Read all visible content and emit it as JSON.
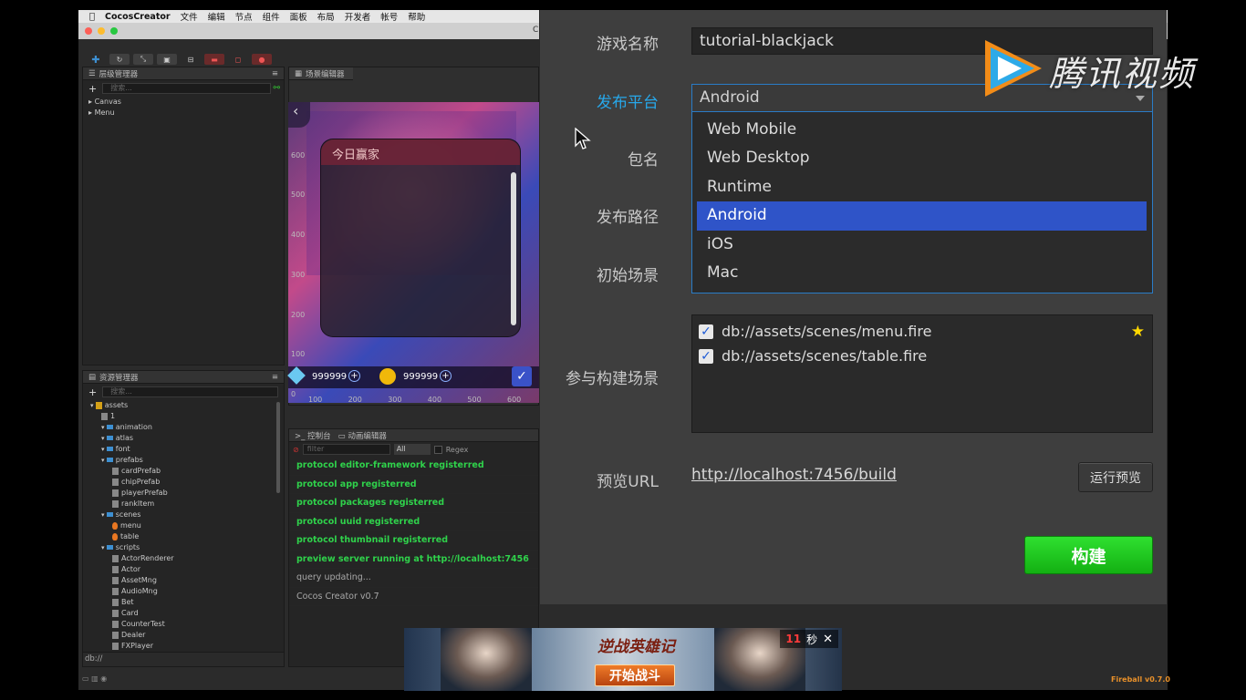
{
  "menubar": {
    "app_name": "CocosCreator",
    "items": [
      "文件",
      "编辑",
      "节点",
      "组件",
      "面板",
      "布局",
      "开发者",
      "帐号",
      "帮助"
    ]
  },
  "window": {
    "title": "C"
  },
  "hierarchy": {
    "title": "层级管理器",
    "search_placeholder": "搜索...",
    "nodes": [
      "Canvas",
      "Menu"
    ]
  },
  "assets": {
    "title": "资源管理器",
    "search_placeholder": "搜索...",
    "tree": [
      {
        "label": "assets",
        "indent": 0,
        "type": "root"
      },
      {
        "label": "1",
        "indent": 1,
        "type": "file"
      },
      {
        "label": "animation",
        "indent": 1,
        "type": "folder"
      },
      {
        "label": "atlas",
        "indent": 1,
        "type": "folder"
      },
      {
        "label": "font",
        "indent": 1,
        "type": "folder"
      },
      {
        "label": "prefabs",
        "indent": 1,
        "type": "folder"
      },
      {
        "label": "cardPrefab",
        "indent": 2,
        "type": "file"
      },
      {
        "label": "chipPrefab",
        "indent": 2,
        "type": "file"
      },
      {
        "label": "playerPrefab",
        "indent": 2,
        "type": "file"
      },
      {
        "label": "rankItem",
        "indent": 2,
        "type": "file"
      },
      {
        "label": "scenes",
        "indent": 1,
        "type": "folder"
      },
      {
        "label": "menu",
        "indent": 2,
        "type": "fire"
      },
      {
        "label": "table",
        "indent": 2,
        "type": "fire"
      },
      {
        "label": "scripts",
        "indent": 1,
        "type": "folder"
      },
      {
        "label": "ActorRenderer",
        "indent": 2,
        "type": "file"
      },
      {
        "label": "Actor",
        "indent": 2,
        "type": "file"
      },
      {
        "label": "AssetMng",
        "indent": 2,
        "type": "file"
      },
      {
        "label": "AudioMng",
        "indent": 2,
        "type": "file"
      },
      {
        "label": "Bet",
        "indent": 2,
        "type": "file"
      },
      {
        "label": "Card",
        "indent": 2,
        "type": "file"
      },
      {
        "label": "CounterTest",
        "indent": 2,
        "type": "file"
      },
      {
        "label": "Dealer",
        "indent": 2,
        "type": "file"
      },
      {
        "label": "FXPlayer",
        "indent": 2,
        "type": "file"
      }
    ],
    "footer_path": "db://"
  },
  "scene_editor": {
    "title": "场景编辑器",
    "card_title": "今日赢家",
    "v_ticks": [
      "600",
      "500",
      "400",
      "300",
      "200",
      "100",
      "0"
    ],
    "h_ticks": [
      "100",
      "200",
      "300",
      "400",
      "500",
      "600"
    ],
    "gems": "999999",
    "coins": "999999"
  },
  "console": {
    "tab_console": "控制台",
    "tab_anim": "动画编辑器",
    "filter_placeholder": "filter",
    "level": "All",
    "regex_label": "Regex",
    "lines": [
      {
        "text": "protocol editor-framework registerred",
        "color": "green"
      },
      {
        "text": "protocol app registerred",
        "color": "green"
      },
      {
        "text": "protocol packages registerred",
        "color": "green"
      },
      {
        "text": "protocol uuid registerred",
        "color": "green"
      },
      {
        "text": "protocol thumbnail registerred",
        "color": "green"
      },
      {
        "text": "preview server running at http://localhost:7456",
        "color": "green"
      },
      {
        "text": "query updating...",
        "color": "gray"
      },
      {
        "text": "Cocos Creator v0.7",
        "color": "gray"
      }
    ]
  },
  "build": {
    "game_name_label": "游戏名称",
    "game_name_value": "tutorial-blackjack",
    "platform_label": "发布平台",
    "platform_value": "Android",
    "platform_options": [
      "Web Mobile",
      "Web Desktop",
      "Runtime",
      "Android",
      "iOS",
      "Mac"
    ],
    "platform_selected_index": 3,
    "package_label": "包名",
    "path_label": "发布路径",
    "start_scene_label": "初始场景",
    "scenes_label": "参与构建场景",
    "scenes": [
      {
        "path": "db://assets/scenes/menu.fire",
        "checked": true,
        "starred": true
      },
      {
        "path": "db://assets/scenes/table.fire",
        "checked": true,
        "starred": false
      }
    ],
    "preview_label": "预览URL",
    "preview_url": "http://localhost:7456/build",
    "run_preview": "运行预览",
    "build_button": "构建"
  },
  "watermark": {
    "text": "腾讯视频"
  },
  "ad": {
    "logo_text": "逆战英雄记",
    "cta": "开始战斗",
    "timer_value": "11",
    "timer_unit": "秒"
  },
  "status": {
    "version": "Fireball v0.7.0"
  },
  "colors": {
    "accent_blue": "#27a8ea",
    "selection": "#2f54c8",
    "build_green": "#1fcf1f",
    "log_green": "#2fd24b"
  }
}
